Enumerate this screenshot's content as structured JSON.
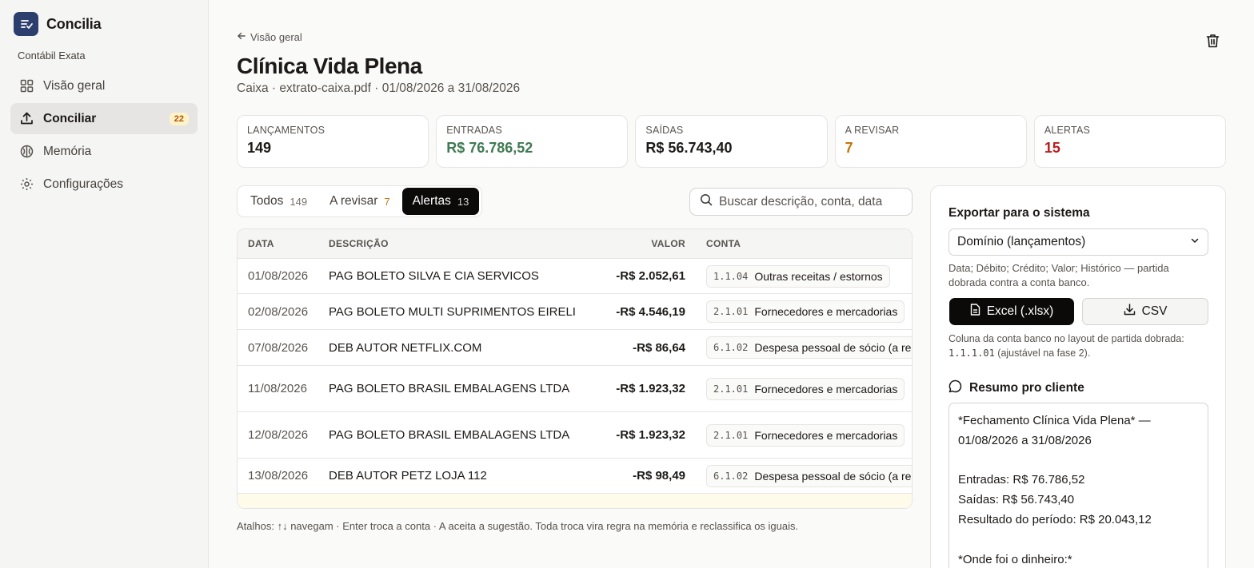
{
  "app": {
    "name": "Concilia",
    "org": "Contábil Exata"
  },
  "sidebar": {
    "items": [
      {
        "label": "Visão geral"
      },
      {
        "label": "Conciliar",
        "badge": "22"
      },
      {
        "label": "Memória"
      },
      {
        "label": "Configurações"
      }
    ]
  },
  "header": {
    "back_label": "Visão geral",
    "title": "Clínica Vida Plena",
    "subtitle": "Caixa · extrato-caixa.pdf · 01/08/2026 a 31/08/2026"
  },
  "stats": [
    {
      "label": "Lançamentos",
      "value": "149",
      "color": "#1c1917"
    },
    {
      "label": "Entradas",
      "value": "R$ 76.786,52",
      "color": "#3f7a52"
    },
    {
      "label": "Saídas",
      "value": "R$ 56.743,40",
      "color": "#1c1917"
    },
    {
      "label": "A revisar",
      "value": "7",
      "color": "#c2760c"
    },
    {
      "label": "Alertas",
      "value": "15",
      "color": "#b91c1c"
    }
  ],
  "tabs": [
    {
      "label": "Todos",
      "count": "149",
      "count_color": "#78716c"
    },
    {
      "label": "A revisar",
      "count": "7",
      "count_color": "#c2760c"
    },
    {
      "label": "Alertas",
      "count": "13",
      "count_color": "#d6d3d1"
    }
  ],
  "search": {
    "placeholder": "Buscar descrição, conta, data"
  },
  "table": {
    "headers": {
      "date": "DATA",
      "desc": "DESCRIÇÃO",
      "value": "VALOR",
      "account": "CONTA"
    },
    "rows": [
      {
        "date": "01/08/2026",
        "desc": "PAG BOLETO SILVA E CIA SERVICOS",
        "value": "-R$ 2.052,61",
        "code": "1.1.04",
        "account": "Outras receitas / estornos"
      },
      {
        "date": "02/08/2026",
        "desc": "PAG BOLETO MULTI SUPRIMENTOS EIRELI",
        "value": "-R$ 4.546,19",
        "code": "2.1.01",
        "account": "Fornecedores e mercadorias"
      },
      {
        "date": "07/08/2026",
        "desc": "DEB AUTOR NETFLIX.COM",
        "value": "-R$ 86,64",
        "code": "6.1.02",
        "account": "Despesa pessoal de sócio (a reclassificar)"
      },
      {
        "date": "11/08/2026",
        "desc": "PAG BOLETO BRASIL EMBALAGENS LTDA",
        "value": "-R$ 1.923,32",
        "code": "2.1.01",
        "account": "Fornecedores e mercadorias"
      },
      {
        "date": "12/08/2026",
        "desc": "PAG BOLETO BRASIL EMBALAGENS LTDA",
        "value": "-R$ 1.923,32",
        "code": "2.1.01",
        "account": "Fornecedores e mercadorias"
      },
      {
        "date": "13/08/2026",
        "desc": "DEB AUTOR PETZ LOJA 112",
        "value": "-R$ 98,49",
        "code": "6.1.02",
        "account": "Despesa pessoal de sócio (a reclassificar)"
      }
    ]
  },
  "shortcuts": "Atalhos: ↑↓ navegam · Enter troca a conta · A aceita a sugestão. Toda troca vira regra na memória e reclassifica os iguais.",
  "export": {
    "title": "Exportar para o sistema",
    "format": "Domínio (lançamentos)",
    "format_hint": "Data; Débito; Crédito; Valor; Histórico — partida dobrada contra a conta banco.",
    "excel_label": "Excel (.xlsx)",
    "csv_label": "CSV",
    "bank_hint_before": "Coluna da conta banco no layout de partida dobrada:",
    "bank_code": "1.1.1.01",
    "bank_hint_after": "(ajustável na fase 2).",
    "resume_title": "Resumo pro cliente",
    "resume_text": "*Fechamento Clínica Vida Plena* — 01/08/2026 a 31/08/2026\n\nEntradas: R$ 76.786,52\nSaídas: R$ 56.743,40\nResultado do período: R$ 20.043,12\n\n*Onde foi o dinheiro:*"
  }
}
